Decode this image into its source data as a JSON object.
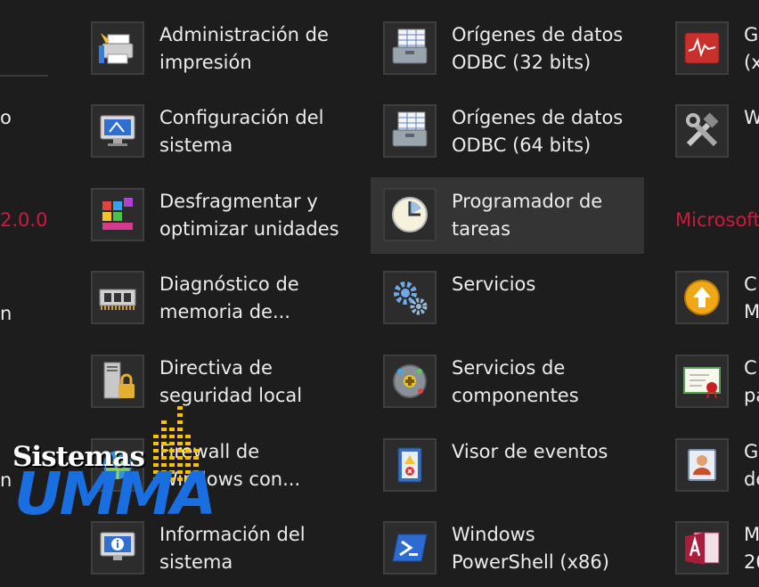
{
  "left_column": {
    "text_o": "o",
    "version_text": "2.0.0",
    "text_n1": "n",
    "text_n2": "n"
  },
  "sections": {
    "microsoft_header": "Microsoft"
  },
  "col1": [
    {
      "line1": "Administración de",
      "line2": "impresión",
      "icon": "printer-icon"
    },
    {
      "line1": "Configuración del",
      "line2": "sistema",
      "icon": "monitor-config-icon"
    },
    {
      "line1": "Desfragmentar y",
      "line2": "optimizar unidades",
      "icon": "defrag-icon"
    },
    {
      "line1": "Diagnóstico de",
      "line2": "memoria de...",
      "icon": "memory-chip-icon"
    },
    {
      "line1": "Directiva de",
      "line2": "seguridad local",
      "icon": "security-policy-icon"
    },
    {
      "line1": "Firewall de",
      "line2": "Windows con...",
      "icon": "firewall-icon"
    },
    {
      "line1": "Información del",
      "line2": "sistema",
      "icon": "system-info-icon"
    }
  ],
  "col2": [
    {
      "line1": "Orígenes de datos",
      "line2": "ODBC (32 bits)",
      "icon": "odbc-icon"
    },
    {
      "line1": "Orígenes de datos",
      "line2": "ODBC (64 bits)",
      "icon": "odbc-icon"
    },
    {
      "line1": "Programador de",
      "line2": "tareas",
      "icon": "clock-icon",
      "selected": true
    },
    {
      "line1": "Servicios",
      "line2": "",
      "icon": "gears-icon"
    },
    {
      "line1": "Servicios de",
      "line2": "componentes",
      "icon": "components-icon"
    },
    {
      "line1": "Visor de eventos",
      "line2": "",
      "icon": "event-viewer-icon"
    },
    {
      "line1": "Windows",
      "line2": "PowerShell (x86)",
      "icon": "powershell-icon"
    }
  ],
  "col3": [
    {
      "line1": "G",
      "line2": "(x",
      "icon": "perf-monitor-icon"
    },
    {
      "line1": "W",
      "line2": "",
      "icon": "tools-icon"
    },
    {
      "line1": "C",
      "line2": "M",
      "icon": "upload-arrow-icon"
    },
    {
      "line1": "C",
      "line2": "pa",
      "icon": "certificate-icon"
    },
    {
      "line1": "G",
      "line2": "de",
      "icon": "user-card-icon"
    },
    {
      "line1": "M",
      "line2": "20",
      "icon": "access-icon"
    }
  ],
  "watermark": {
    "top_text": "Sistemas",
    "bottom_text": "UMMA"
  },
  "colors": {
    "background": "#1d1d1d",
    "accent_red": "#d2183e",
    "selected_tile": "#343434",
    "watermark_blue": "#1a6fe0",
    "watermark_yellow": "#f5c400"
  }
}
